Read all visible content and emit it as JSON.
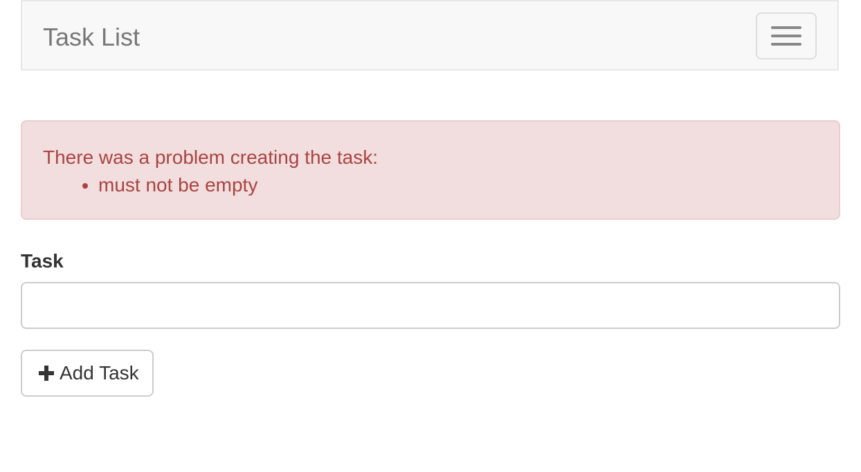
{
  "navbar": {
    "brand": "Task List",
    "toggle_icon": "hamburger-menu-icon"
  },
  "alert": {
    "heading": "There was a problem creating the task:",
    "errors": [
      "must not be empty"
    ],
    "colors": {
      "background": "#f2dede",
      "border": "#ebccd1",
      "text": "#a94442"
    }
  },
  "form": {
    "task_label": "Task",
    "task_value": "",
    "add_button_label": "Add Task",
    "add_button_icon": "plus-icon"
  }
}
